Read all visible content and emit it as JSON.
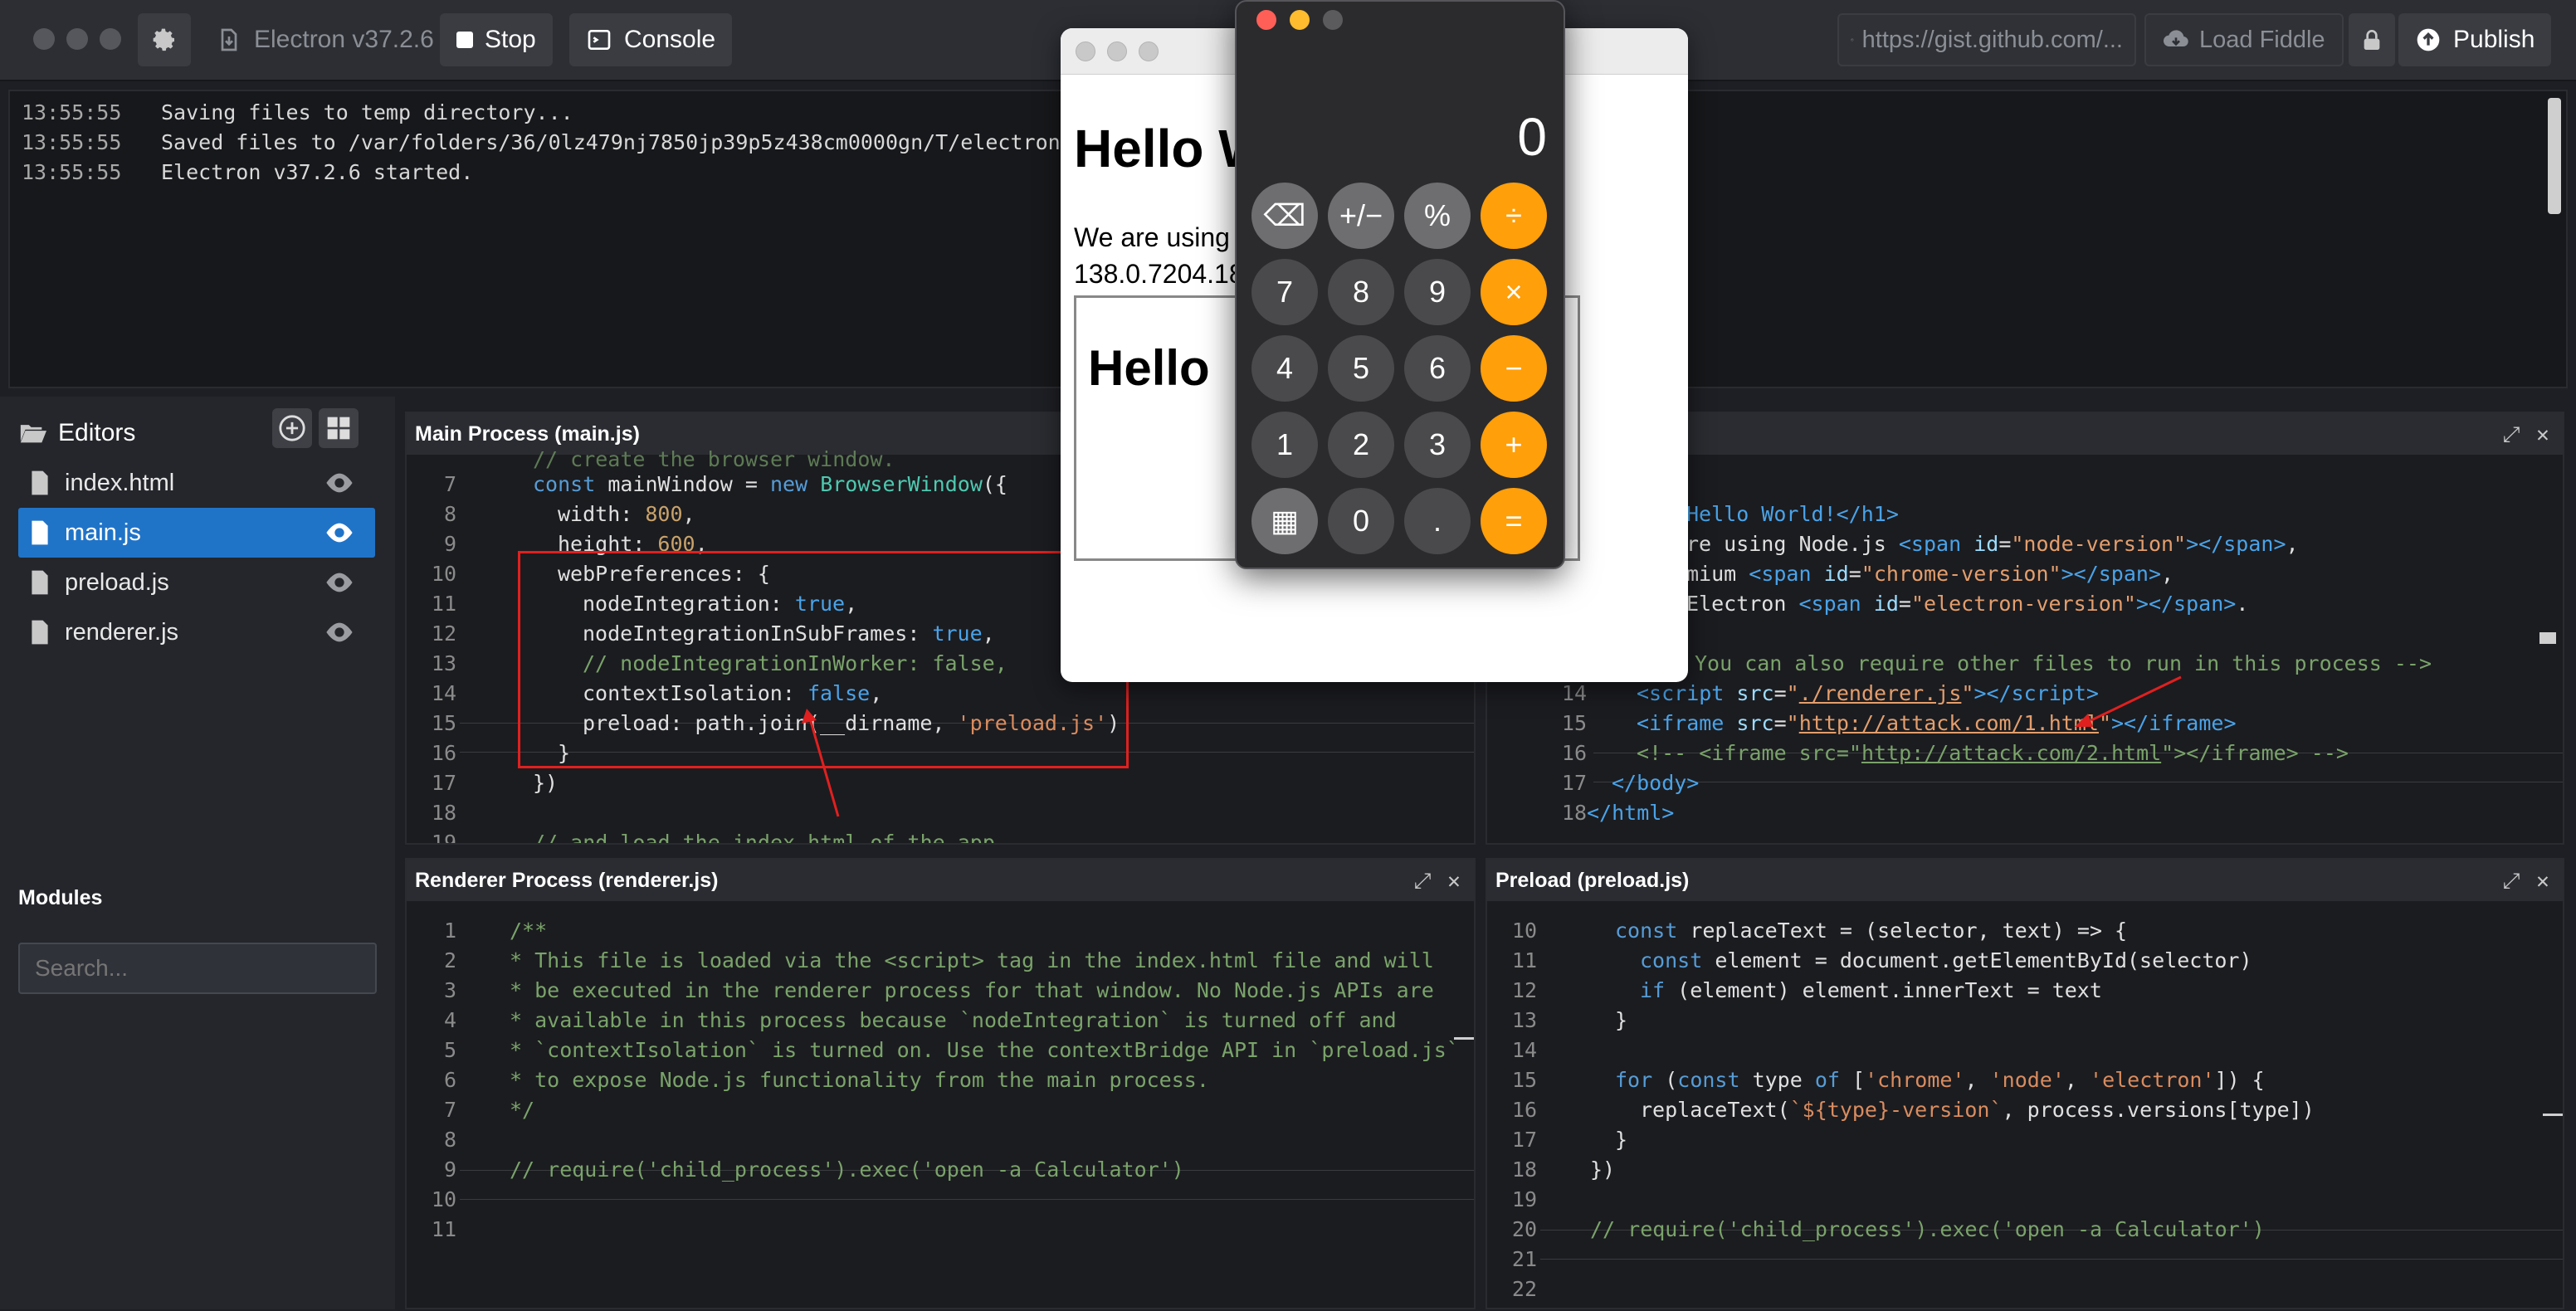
{
  "toolbar": {
    "version_label": "Electron v37.2.6",
    "stop_label": "Stop",
    "console_label": "Console",
    "gist_url": "https://gist.github.com/...",
    "load_fiddle_label": "Load Fiddle",
    "publish_label": "Publish"
  },
  "console": {
    "lines": [
      {
        "time": "13:55:55",
        "text": "Saving files to temp directory..."
      },
      {
        "time": "13:55:55",
        "text": "Saved files to /var/folders/36/0lz479nj7850jp39p5z438cm0000gn/T/electron-fi"
      },
      {
        "time": "13:55:55",
        "text": "Electron v37.2.6 started."
      }
    ]
  },
  "sidebar": {
    "editors_label": "Editors",
    "files": [
      "index.html",
      "main.js",
      "preload.js",
      "renderer.js"
    ],
    "modules_label": "Modules",
    "search_placeholder": "Search..."
  },
  "panes": {
    "main": {
      "title": "Main Process (main.js)"
    },
    "renderer": {
      "title": "Renderer Process (renderer.js)"
    },
    "preload": {
      "title": "Preload (preload.js)"
    }
  },
  "electron_window": {
    "heading": "Hello W",
    "line1": "We are using",
    "line2": "138.0.7204.18",
    "iframe_heading": "Hello"
  },
  "calculator": {
    "display": "0",
    "keys": [
      [
        "⌫",
        "+/−",
        "%",
        "÷"
      ],
      [
        "7",
        "8",
        "9",
        "×"
      ],
      [
        "4",
        "5",
        "6",
        "−"
      ],
      [
        "1",
        "2",
        "3",
        "+"
      ],
      [
        "▦",
        "0",
        ".",
        "="
      ]
    ]
  },
  "colors": {
    "accent": "#2074c8",
    "calc_orange": "#ff9f0a",
    "annotation_red": "#e0201f"
  }
}
